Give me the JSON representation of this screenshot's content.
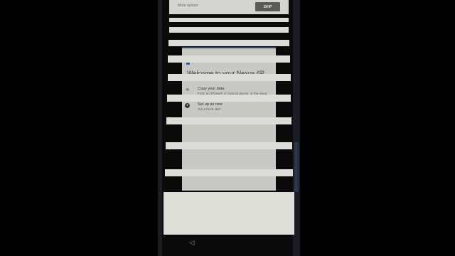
{
  "topbar": {
    "more_options_label": "More options",
    "skip_label": "SKIP"
  },
  "setup": {
    "title": "Welcome to your Nexus 6P",
    "options": [
      {
        "title": "Copy your data",
        "subtitle": "From an iPhone® or Android device, or the cloud",
        "icon": "cloud-copy-icon"
      },
      {
        "title": "Set up as new",
        "subtitle": "Get a fresh start",
        "icon": "new-device-icon"
      }
    ]
  },
  "navbar": {
    "back_icon": "back-triangle-icon",
    "back_glyph": "◁"
  }
}
